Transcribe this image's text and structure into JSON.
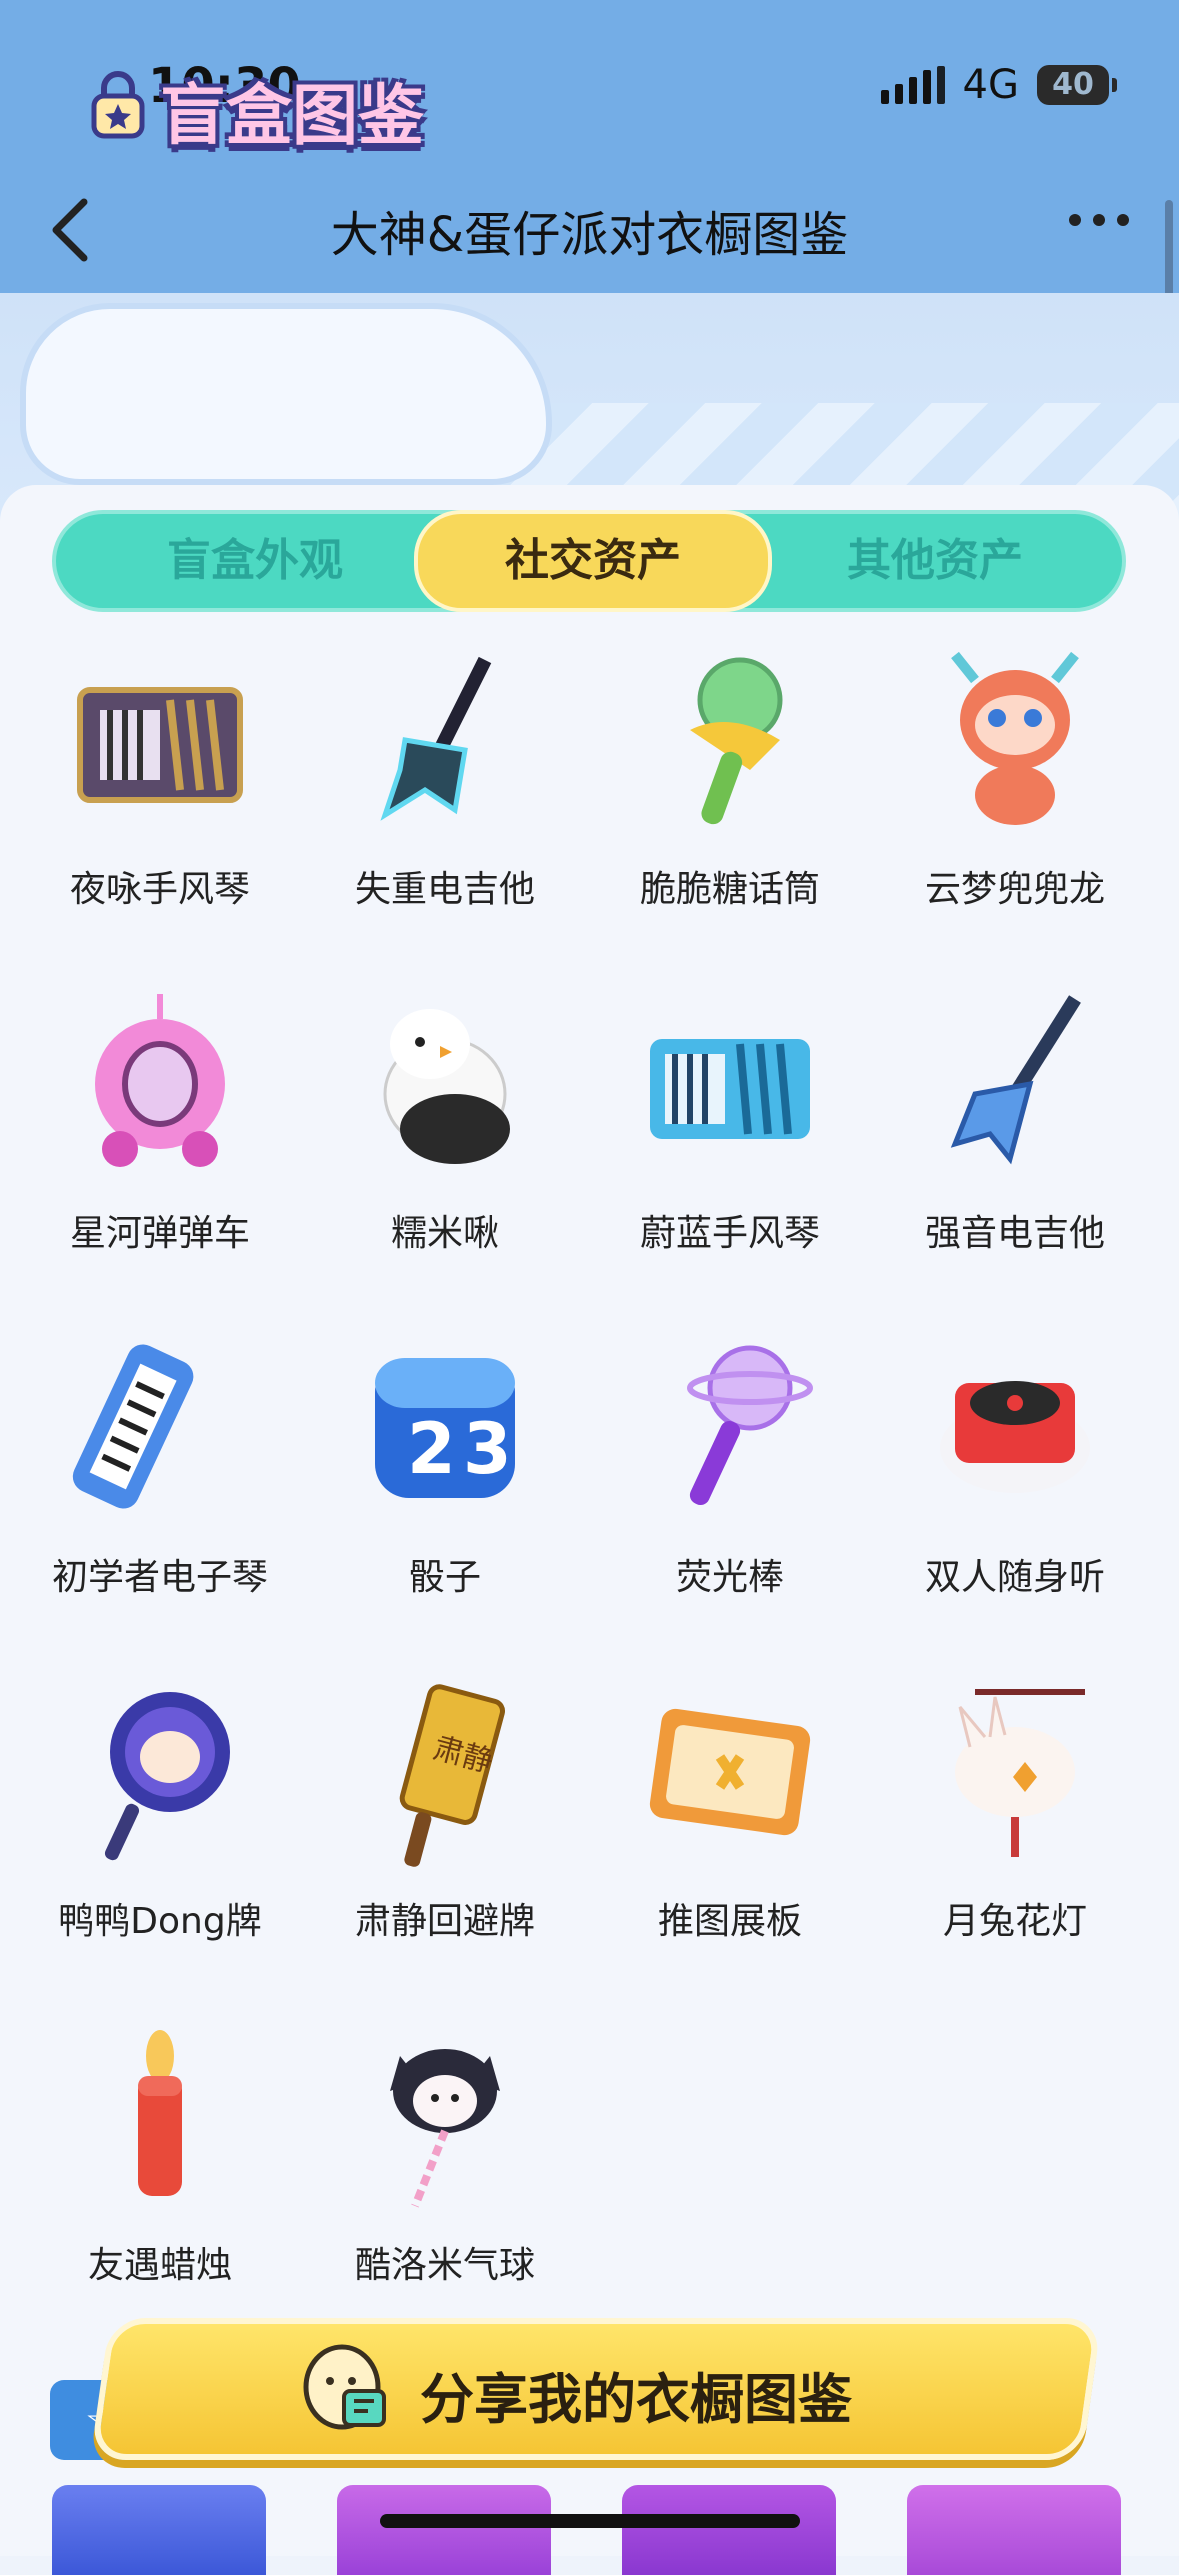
{
  "status_bar": {
    "time": "10:30",
    "network": "4G",
    "battery": "40"
  },
  "nav": {
    "title": "大神&蛋仔派对衣橱图鉴"
  },
  "banner": {
    "title": "盲盒图鉴"
  },
  "tabs": [
    {
      "label": "盲盒外观",
      "active": false
    },
    {
      "label": "社交资产",
      "active": true
    },
    {
      "label": "其他资产",
      "active": false
    }
  ],
  "items": [
    {
      "name": "夜咏手风琴",
      "icon": "accordion-dark-icon"
    },
    {
      "name": "失重电吉他",
      "icon": "electric-guitar-dark-icon"
    },
    {
      "name": "脆脆糖话筒",
      "icon": "candy-microphone-icon"
    },
    {
      "name": "云梦兜兜龙",
      "icon": "dragon-icon"
    },
    {
      "name": "星河弹弹车",
      "icon": "pink-car-icon"
    },
    {
      "name": "糯米啾",
      "icon": "penguin-bird-icon"
    },
    {
      "name": "蔚蓝手风琴",
      "icon": "accordion-blue-icon"
    },
    {
      "name": "强音电吉他",
      "icon": "electric-guitar-blue-icon"
    },
    {
      "name": "初学者电子琴",
      "icon": "keyboard-icon"
    },
    {
      "name": "骰子",
      "icon": "dice-icon"
    },
    {
      "name": "荧光棒",
      "icon": "glowstick-icon"
    },
    {
      "name": "双人随身听",
      "icon": "record-player-icon"
    },
    {
      "name": "鸭鸭Dong牌",
      "icon": "duck-sign-icon"
    },
    {
      "name": "肃静回避牌",
      "icon": "silence-sign-icon"
    },
    {
      "name": "推图展板",
      "icon": "display-board-icon"
    },
    {
      "name": "月兔花灯",
      "icon": "rabbit-lantern-icon"
    },
    {
      "name": "友遇蜡烛",
      "icon": "candle-icon"
    },
    {
      "name": "酷洛米气球",
      "icon": "kuromi-balloon-icon"
    }
  ],
  "share_button": {
    "label": "分享我的衣橱图鉴"
  },
  "colors": {
    "header": "#74ade6",
    "tab_bar": "#4cd9c2",
    "tab_active": "#f8d85a",
    "share": "#f5c534"
  }
}
